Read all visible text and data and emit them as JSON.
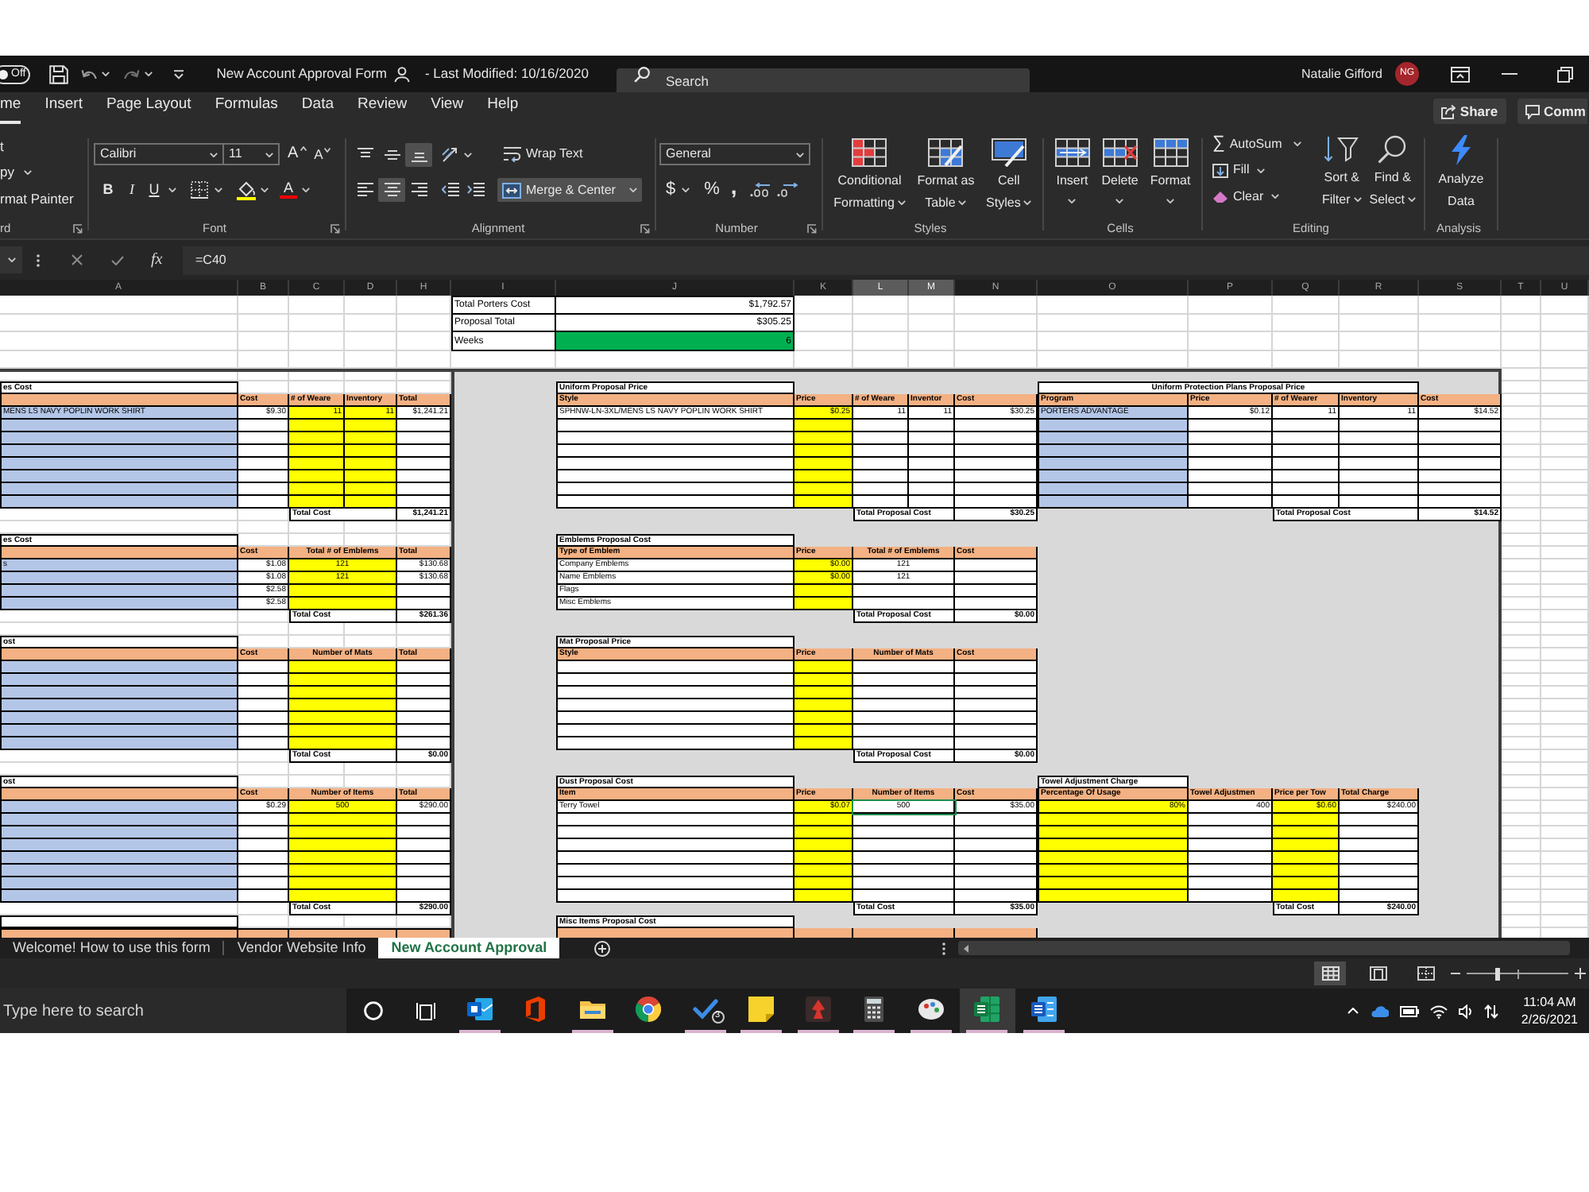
{
  "title_bar": {
    "autosave": {
      "label": "Off",
      "on": false
    },
    "title": "New Account Approval Form",
    "modified": "- Last Modified: 10/16/2020",
    "search": {
      "placeholder": "Search"
    },
    "user_name": "Natalie Gifford",
    "initials": "NG"
  },
  "ribbon_tabs": [
    {
      "label": "me",
      "selected": true
    },
    {
      "label": "Insert",
      "selected": false
    },
    {
      "label": "Page Layout",
      "selected": false
    },
    {
      "label": "Formulas",
      "selected": false
    },
    {
      "label": "Data",
      "selected": false
    },
    {
      "label": "Review",
      "selected": false
    },
    {
      "label": "View",
      "selected": false
    },
    {
      "label": "Help",
      "selected": false
    }
  ],
  "share": "Share",
  "comments": "Comm",
  "ribbon": {
    "clipboard": {
      "cut": "t",
      "copy": "py",
      "format_painter": "rmat Painter",
      "label": "rd"
    },
    "font": {
      "family": "Calibri",
      "size": "11",
      "grow": "A",
      "shrink": "A",
      "bold": "B",
      "italic": "I",
      "underline": "U",
      "font_color": "A",
      "label": "Font"
    },
    "alignment": {
      "vertical": [
        {
          "selected": false
        },
        {
          "selected": false
        },
        {
          "selected": true
        }
      ],
      "horizontal": [
        {
          "selected": false
        },
        {
          "selected": true
        },
        {
          "selected": false
        }
      ],
      "wrap_text": "Wrap Text",
      "merge": {
        "label": "Merge & Center",
        "selected": true
      },
      "label": "Alignment"
    },
    "number": {
      "format": "General",
      "currency": "$",
      "percent": "%",
      "comma": ",",
      "label": "Number"
    },
    "styles": {
      "buttons": [
        [
          "Conditional",
          "Formatting"
        ],
        [
          "Format as",
          "Table"
        ],
        [
          "Cell",
          "Styles"
        ]
      ],
      "label": "Styles"
    },
    "cells": {
      "buttons": [
        "Insert",
        "Delete",
        "Format"
      ],
      "label": "Cells"
    },
    "editing": {
      "autosum_symbol": "∑",
      "autosum": "AutoSum",
      "fill": "Fill",
      "clear": "Clear",
      "sort": [
        "Sort &",
        "Filter"
      ],
      "find": [
        "Find &",
        "Select"
      ],
      "label": "Editing"
    },
    "analysis": {
      "button": [
        "Analyze",
        "Data"
      ],
      "label": "Analysis"
    }
  },
  "formula_bar": {
    "function_label": "fx",
    "formula": "=C40"
  },
  "columns": [
    {
      "label": "A",
      "selected": false
    },
    {
      "label": "B",
      "selected": false
    },
    {
      "label": "C",
      "selected": false
    },
    {
      "label": "D",
      "selected": false
    },
    {
      "label": "H",
      "selected": false
    },
    {
      "label": "I",
      "selected": false
    },
    {
      "label": "J",
      "selected": false
    },
    {
      "label": "K",
      "selected": false
    },
    {
      "label": "L",
      "selected": true
    },
    {
      "label": "M",
      "selected": true
    },
    {
      "label": "N",
      "selected": false
    },
    {
      "label": "O",
      "selected": false
    },
    {
      "label": "P",
      "selected": false
    },
    {
      "label": "Q",
      "selected": false
    },
    {
      "label": "R",
      "selected": false
    },
    {
      "label": "S",
      "selected": false
    },
    {
      "label": "T",
      "selected": false
    },
    {
      "label": "U",
      "selected": false
    }
  ],
  "sheet": {
    "summary": [
      {
        "label": "Total Porters Cost",
        "value": "$1,792.57"
      },
      {
        "label": "Proposal Total",
        "value": "$305.25"
      },
      {
        "label": "Weeks",
        "value": "6",
        "color": "#00b050"
      }
    ],
    "tables": [
      {
        "title": "es Cost",
        "columns": [
          {
            "kind": "lookup"
          },
          {
            "header": "Cost",
            "kind": "plain"
          },
          {
            "header": "# of Weare",
            "kind": "input"
          },
          {
            "header": "Inventory",
            "kind": "input"
          },
          {
            "header": "Total",
            "kind": "plain"
          }
        ],
        "rows": [
          [
            "MENS LS NAVY POPLIN WORK SHIRT",
            "$9.30",
            "11",
            "11",
            "$1,241.21"
          ]
        ],
        "total": {
          "label": "Total Cost",
          "value": "$1,241.21"
        }
      },
      {
        "title": "Uniform Proposal Price",
        "columns": [
          {
            "header": "Style",
            "kind": "plain"
          },
          {
            "header": "Price",
            "kind": "input"
          },
          {
            "header": "# of Weare",
            "kind": "plain"
          },
          {
            "header": "Inventor",
            "kind": "plain"
          },
          {
            "header": "Cost",
            "kind": "plain"
          }
        ],
        "rows": [
          [
            "SPHNW-LN-3XL/MENS LS NAVY POPLIN WORK SHIRT",
            "$0.25",
            "11",
            "11",
            "$30.25"
          ]
        ],
        "total": {
          "label": "Total Proposal Cost",
          "value": "$30.25"
        }
      },
      {
        "title": "Uniform Protection Plans Proposal Price",
        "columns": [
          {
            "header": "Program",
            "kind": "lookup"
          },
          {
            "header": "Price",
            "kind": "plain"
          },
          {
            "header": "# of Wearer",
            "kind": "plain"
          },
          {
            "header": "Inventory",
            "kind": "plain"
          },
          {
            "header": "Cost",
            "kind": "plain"
          }
        ],
        "rows": [
          [
            "PORTERS ADVANTAGE",
            "$0.12",
            "11",
            "11",
            "$14.52"
          ]
        ],
        "total": {
          "label": "Total Proposal Cost",
          "value": "$14.52"
        }
      },
      {
        "title": "es Cost",
        "columns": [
          {
            "kind": "lookup"
          },
          {
            "header": "Cost",
            "kind": "plain"
          },
          {
            "header": "Total # of Emblems",
            "kind": "input"
          },
          {
            "header": "Total",
            "kind": "plain"
          }
        ],
        "rows": [
          [
            "s",
            "$1.08",
            "121",
            "$130.68"
          ],
          [
            null,
            "$1.08",
            "121",
            "$130.68"
          ],
          [
            null,
            "$2.58"
          ],
          [
            null,
            "$2.58"
          ]
        ],
        "total": {
          "label": "Total Cost",
          "value": "$261.36"
        }
      },
      {
        "title": "Emblems Proposal Cost",
        "columns": [
          {
            "header": "Type of Emblem",
            "kind": "plain"
          },
          {
            "header": "Price",
            "kind": "input"
          },
          {
            "header": "Total # of Emblems",
            "kind": "plain"
          },
          {
            "header": "Cost",
            "kind": "plain"
          }
        ],
        "rows": [
          [
            "Company Emblems",
            "$0.00",
            "121"
          ],
          [
            "Name Emblems",
            "$0.00",
            "121"
          ],
          [
            "Flags"
          ],
          [
            "Misc Emblems"
          ]
        ],
        "total": {
          "label": "Total Proposal Cost",
          "value": "$0.00"
        }
      },
      {
        "title": "ost",
        "columns": [
          {
            "kind": "lookup"
          },
          {
            "header": "Cost",
            "kind": "plain"
          },
          {
            "header": "Number of Mats",
            "kind": "input"
          },
          {
            "header": "Total",
            "kind": "plain"
          }
        ],
        "total": {
          "label": "Total Cost",
          "value": "$0.00"
        }
      },
      {
        "title": "Mat Proposal Price",
        "columns": [
          {
            "header": "Style",
            "kind": "plain"
          },
          {
            "header": "Price",
            "kind": "input"
          },
          {
            "header": "Number of Mats",
            "kind": "plain"
          },
          {
            "header": "Cost",
            "kind": "plain"
          }
        ],
        "total": {
          "label": "Total Proposal Cost",
          "value": "$0.00"
        }
      },
      {
        "title": "ost",
        "columns": [
          {
            "kind": "lookup"
          },
          {
            "header": "Cost",
            "kind": "plain"
          },
          {
            "header": "Number of Items",
            "kind": "input"
          },
          {
            "header": "Total",
            "kind": "plain"
          }
        ],
        "rows": [
          [
            null,
            "$0.29",
            "500",
            "$290.00"
          ]
        ],
        "total": {
          "label": "Total Cost",
          "value": "$290.00"
        }
      },
      {
        "title": "Dust Proposal Cost",
        "columns": [
          {
            "header": "Item",
            "kind": "plain"
          },
          {
            "header": "Price",
            "kind": "input"
          },
          {
            "header": "Number of Items",
            "kind": "plain"
          },
          {
            "header": "Cost",
            "kind": "plain"
          }
        ],
        "rows": [
          [
            "Terry Towel",
            "$0.07",
            {
              "text": "500",
              "active": true
            },
            "$35.00"
          ]
        ],
        "total": {
          "label": "Total Cost",
          "value": "$35.00"
        }
      },
      {
        "title": "Towel Adjustment Charge",
        "columns": [
          {
            "header": "Percentage Of Usage",
            "kind": "input"
          },
          {
            "header": "Towel Adjustmen",
            "kind": "plain"
          },
          {
            "header": "Price per Tow",
            "kind": "input"
          },
          {
            "header": "Total Charge",
            "kind": "plain"
          }
        ],
        "rows": [
          [
            "80%",
            "400",
            "$0.60",
            "$240.00"
          ]
        ],
        "total": {
          "label": "Total Cost",
          "value": "$240.00"
        }
      },
      {
        "title": "Misc Items Proposal Cost"
      }
    ]
  },
  "sheet_tabs": [
    {
      "label": "Welcome! How to use this form",
      "selected": false
    },
    {
      "label": "Vendor Website Info",
      "selected": false
    },
    {
      "label": "New Account Approval",
      "selected": true
    }
  ],
  "status_bar": {
    "views": [
      {
        "selected": true
      },
      {
        "selected": false
      },
      {
        "selected": false
      }
    ],
    "zoom": {
      "level": 0.3
    }
  },
  "taskbar": {
    "search": {
      "placeholder": "Type here to search"
    },
    "apps": [
      {
        "running": true,
        "selected": false
      },
      {
        "running": false,
        "selected": false
      },
      {
        "running": true,
        "selected": false
      },
      {
        "running": false,
        "selected": false
      },
      {
        "running": true,
        "selected": false,
        "badge": "3"
      },
      {
        "running": true,
        "selected": false
      },
      {
        "running": true,
        "selected": false
      },
      {
        "running": true,
        "selected": false
      },
      {
        "running": true,
        "selected": false
      },
      {
        "running": true,
        "selected": true
      },
      {
        "running": true,
        "selected": false
      }
    ],
    "time": "11:04 AM",
    "date": "2/26/2021"
  }
}
